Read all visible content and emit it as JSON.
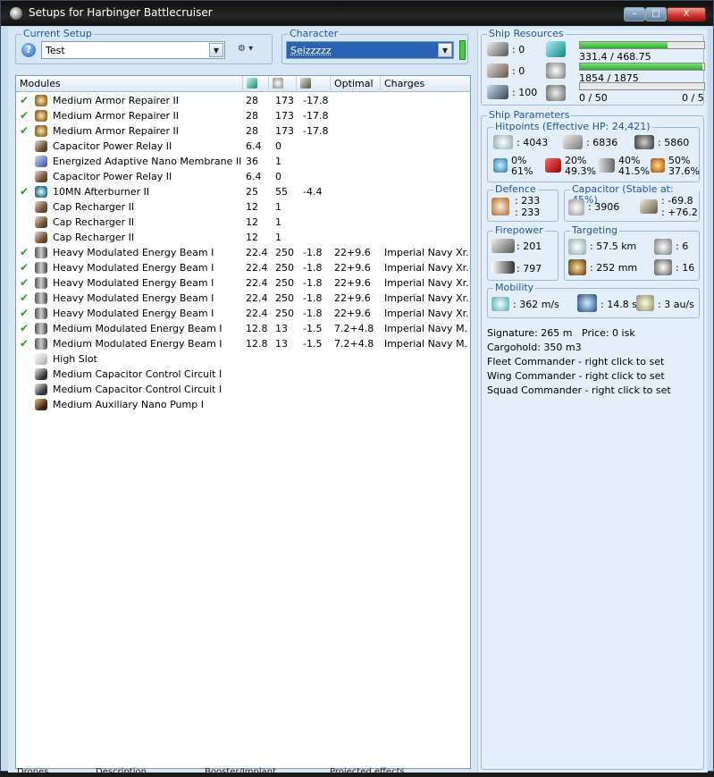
{
  "window": {
    "title": "Setups for Harbinger Battlecruiser",
    "min": "–",
    "max": "□",
    "close": "X"
  },
  "setup": {
    "label": "Current Setup",
    "value": "Test",
    "help": "?"
  },
  "character": {
    "label": "Character",
    "value": "Seizzzzz"
  },
  "modules": {
    "columns": [
      "Modules",
      "",
      "",
      "",
      "Optimal",
      "Charges"
    ],
    "rows": [
      {
        "ok": true,
        "icon": "armor-repairer-icon",
        "name": "Medium Armor Repairer II",
        "cpu": "28",
        "pg": "173",
        "cap": "-17.8",
        "optimal": "",
        "charges": ""
      },
      {
        "ok": true,
        "icon": "armor-repairer-icon",
        "name": "Medium Armor Repairer II",
        "cpu": "28",
        "pg": "173",
        "cap": "-17.8",
        "optimal": "",
        "charges": ""
      },
      {
        "ok": true,
        "icon": "armor-repairer-icon",
        "name": "Medium Armor Repairer II",
        "cpu": "28",
        "pg": "173",
        "cap": "-17.8",
        "optimal": "",
        "charges": ""
      },
      {
        "ok": false,
        "icon": "capacitor-relay-icon",
        "name": "Capacitor Power Relay II",
        "cpu": "6.4",
        "pg": "0",
        "cap": "",
        "optimal": "",
        "charges": ""
      },
      {
        "ok": false,
        "icon": "nano-membrane-icon",
        "name": "Energized Adaptive Nano Membrane II",
        "cpu": "36",
        "pg": "1",
        "cap": "",
        "optimal": "",
        "charges": ""
      },
      {
        "ok": false,
        "icon": "capacitor-relay-icon",
        "name": "Capacitor Power Relay II",
        "cpu": "6.4",
        "pg": "0",
        "cap": "",
        "optimal": "",
        "charges": ""
      },
      {
        "ok": true,
        "icon": "afterburner-icon",
        "name": "10MN Afterburner II",
        "cpu": "25",
        "pg": "55",
        "cap": "-4.4",
        "optimal": "",
        "charges": ""
      },
      {
        "ok": false,
        "icon": "cap-recharger-icon",
        "name": "Cap Recharger II",
        "cpu": "12",
        "pg": "1",
        "cap": "",
        "optimal": "",
        "charges": ""
      },
      {
        "ok": false,
        "icon": "cap-recharger-icon",
        "name": "Cap Recharger II",
        "cpu": "12",
        "pg": "1",
        "cap": "",
        "optimal": "",
        "charges": ""
      },
      {
        "ok": false,
        "icon": "cap-recharger-icon",
        "name": "Cap Recharger II",
        "cpu": "12",
        "pg": "1",
        "cap": "",
        "optimal": "",
        "charges": ""
      },
      {
        "ok": true,
        "icon": "laser-icon",
        "name": "Heavy Modulated Energy Beam I",
        "cpu": "22.4",
        "pg": "250",
        "cap": "-1.8",
        "optimal": "22+9.6",
        "charges": "Imperial Navy Xr..."
      },
      {
        "ok": true,
        "icon": "laser-icon",
        "name": "Heavy Modulated Energy Beam I",
        "cpu": "22.4",
        "pg": "250",
        "cap": "-1.8",
        "optimal": "22+9.6",
        "charges": "Imperial Navy Xr..."
      },
      {
        "ok": true,
        "icon": "laser-icon",
        "name": "Heavy Modulated Energy Beam I",
        "cpu": "22.4",
        "pg": "250",
        "cap": "-1.8",
        "optimal": "22+9.6",
        "charges": "Imperial Navy Xr..."
      },
      {
        "ok": true,
        "icon": "laser-icon",
        "name": "Heavy Modulated Energy Beam I",
        "cpu": "22.4",
        "pg": "250",
        "cap": "-1.8",
        "optimal": "22+9.6",
        "charges": "Imperial Navy Xr..."
      },
      {
        "ok": true,
        "icon": "laser-icon",
        "name": "Heavy Modulated Energy Beam I",
        "cpu": "22.4",
        "pg": "250",
        "cap": "-1.8",
        "optimal": "22+9.6",
        "charges": "Imperial Navy Xr..."
      },
      {
        "ok": true,
        "icon": "laser-icon",
        "name": "Medium Modulated Energy Beam I",
        "cpu": "12.8",
        "pg": "13",
        "cap": "-1.5",
        "optimal": "7.2+4.8",
        "charges": "Imperial Navy M..."
      },
      {
        "ok": true,
        "icon": "laser-icon",
        "name": "Medium Modulated Energy Beam I",
        "cpu": "12.8",
        "pg": "13",
        "cap": "-1.5",
        "optimal": "7.2+4.8",
        "charges": "Imperial Navy M..."
      },
      {
        "ok": false,
        "icon": "high-slot-icon",
        "name": "High Slot",
        "cpu": "",
        "pg": "",
        "cap": "",
        "optimal": "",
        "charges": ""
      },
      {
        "ok": false,
        "icon": "rig-icon",
        "name": "Medium Capacitor Control Circuit I",
        "cpu": "",
        "pg": "",
        "cap": "",
        "optimal": "",
        "charges": ""
      },
      {
        "ok": false,
        "icon": "rig-icon",
        "name": "Medium Capacitor Control Circuit I",
        "cpu": "",
        "pg": "",
        "cap": "",
        "optimal": "",
        "charges": ""
      },
      {
        "ok": false,
        "icon": "rig-icon",
        "name": "Medium Auxiliary Nano Pump I",
        "cpu": "",
        "pg": "",
        "cap": "",
        "optimal": "",
        "charges": ""
      }
    ]
  },
  "bottom_tabs": [
    "Drones",
    "Description",
    "Booster/Implant...",
    "Projected effects"
  ],
  "resources": {
    "label": "Ship Resources",
    "turrets": "0",
    "launchers": "0",
    "calibration": "100",
    "cpu": "331.4 / 468.75",
    "cpu_fraction": 0.707,
    "powergrid": "1854 / 1875",
    "powergrid_fraction": 0.989,
    "drones": "0 / 50",
    "drones_fraction": 0,
    "drone_count": "0 / 5"
  },
  "params": {
    "label": "Ship Parameters",
    "hp_label": "Hitpoints (Effective HP: 24,421)",
    "shield_hp": ": 4043",
    "armor_hp": ": 6836",
    "structure_hp": ": 5860",
    "res_em_top": "0%",
    "res_em_bot": "61%",
    "res_th_top": "20%",
    "res_th_bot": "49.3%",
    "res_ki_top": "40%",
    "res_ki_bot": "41.5%",
    "res_ex_top": "50%",
    "res_ex_bot": "37.6%",
    "defence_label": "Defence",
    "def_top": ": 233",
    "def_bot": ": 233",
    "cap_label": "Capacitor (Stable at: 45%)",
    "cap_amount": ": 3906",
    "cap_top": ": -69.8",
    "cap_bot": ": +76.2",
    "fire_label": "Firepower",
    "dps": ": 201",
    "volley": ": 797",
    "target_label": "Targeting",
    "range": ": 57.5 km",
    "max_targets": ": 6",
    "scan": ": 252 mm",
    "sensor": ": 16",
    "mobility_label": "Mobility",
    "speed": ": 362 m/s",
    "align": ": 14.8 s",
    "warp": ": 3 au/s",
    "signature": "Signature: 265 m",
    "price": "Price: 0 isk",
    "cargo": "Cargohold: 350 m3",
    "fleet": "Fleet Commander - right click to set",
    "wing": "Wing Commander - right click to set",
    "squad": "Squad Commander - right click to set"
  },
  "colors": {
    "accent": "#1e56a8",
    "bar_fill": "#2cae2c",
    "panel": "#e4eef8"
  }
}
